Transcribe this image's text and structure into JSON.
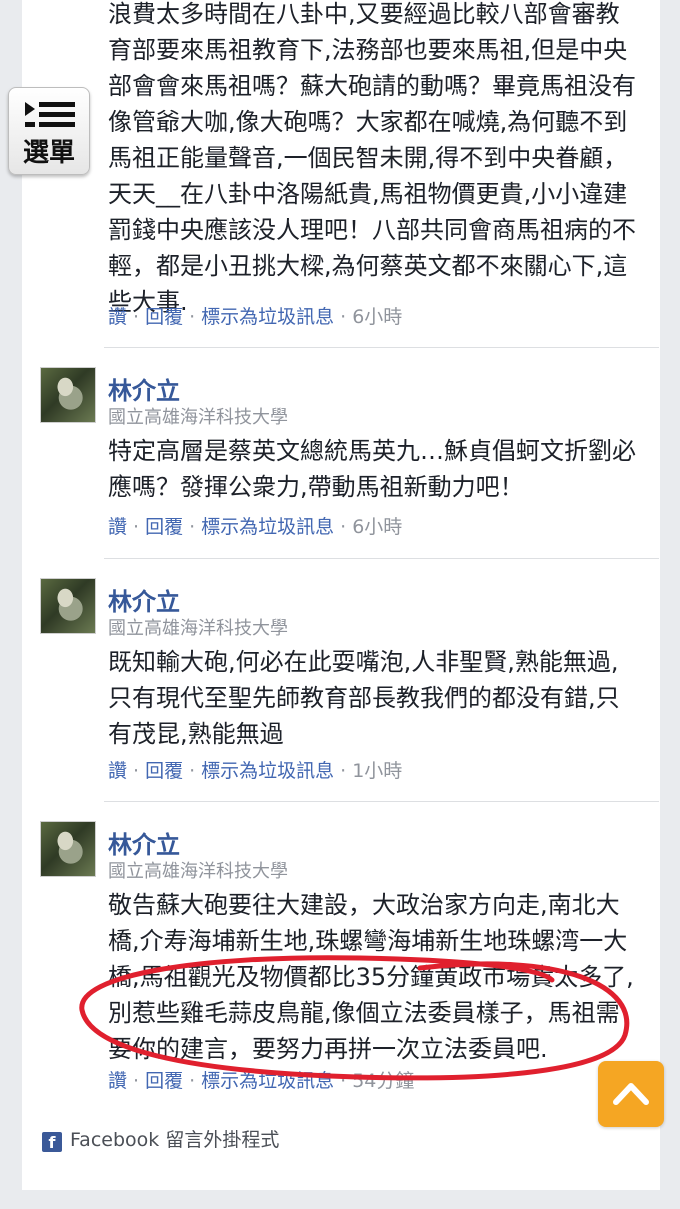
{
  "menu": {
    "label": "選單"
  },
  "comments": [
    {
      "text": "浪費太多時間在八卦中,又要經過比較八部會審教育部要來馬祖教育下,法務部也要來馬祖,但是中央部會會來馬祖嗎？蘇大砲請的動嗎？畢竟馬祖没有像管爺大咖,像大砲嗎？大家都在喊燒,為何聽不到馬祖正能量聲音,一個民智未開,得不到中央眷顧，天天__在八卦中洛陽紙貴,馬祖物價更貴,小小違建罰錢中央應該没人理吧！八部共同會商馬祖病的不輕，都是小丑挑大樑,為何蔡英文都不來關心下,這些大事.",
      "actions": {
        "like": "讚",
        "reply": "回覆",
        "spam": "標示為垃圾訊息",
        "time": "6小時"
      }
    },
    {
      "name": "林介立",
      "school": "國立高雄海洋科技大學",
      "text": "特定高層是蔡英文總統馬英九…穌貞倡蚵文折劉必應嗎？發揮公衆力,帶動馬祖新動力吧！",
      "actions": {
        "like": "讚",
        "reply": "回覆",
        "spam": "標示為垃圾訊息",
        "time": "6小時"
      }
    },
    {
      "name": "林介立",
      "school": "國立高雄海洋科技大學",
      "text": "既知輸大砲,何必在此耍嘴泡,人非聖賢,熟能無過,只有現代至聖先師教育部長教我們的都没有錯,只有茂昆,熟能無過",
      "actions": {
        "like": "讚",
        "reply": "回覆",
        "spam": "標示為垃圾訊息",
        "time": "1小時"
      }
    },
    {
      "name": "林介立",
      "school": "國立高雄海洋科技大學",
      "text": "敬告蘇大砲要往大建設，大政治家方向走,南北大橋,介寿海埔新生地,珠螺彎海埔新生地珠螺湾一大橋,馬祖觀光及物價都比35分鐘黄政市場貴太多了,別惹些雞毛蒜皮鳥龍,像個立法委員樣子，馬祖需要你的建言，要努力再拼一次立法委員吧.",
      "actions": {
        "like": "讚",
        "reply": "回覆",
        "spam": "標示為垃圾訊息",
        "time": "54分鐘"
      }
    }
  ],
  "footer": {
    "plugin_label": "Facebook 留言外掛程式",
    "fb_icon": "f"
  },
  "colors": {
    "name": "#365899",
    "link": "#4267b2",
    "highlight": "#e0202e",
    "top_button": "#f5a623"
  },
  "icons": {
    "menu": "list-icon",
    "top": "chevron-up-icon"
  }
}
